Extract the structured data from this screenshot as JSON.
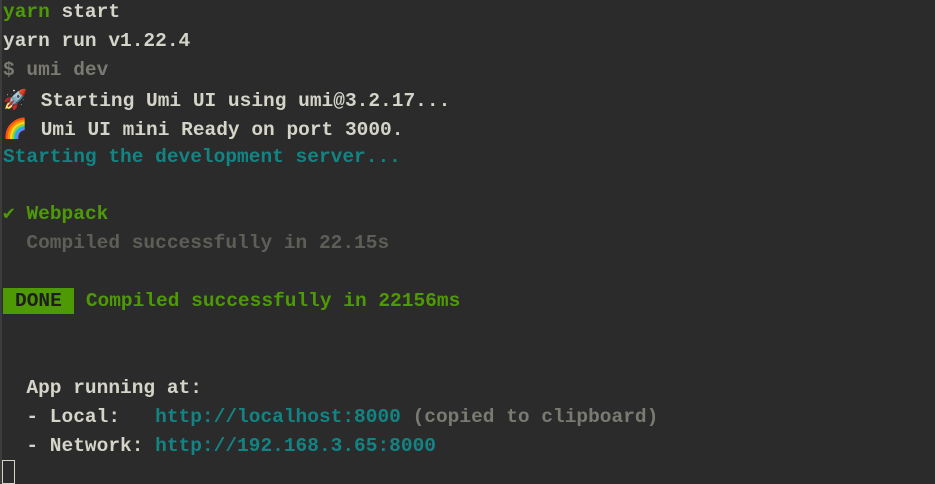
{
  "colors": {
    "background": "#2b2b2b",
    "green": "#4e9a06",
    "teal": "#138484",
    "text": "#d4d4c8"
  },
  "lines": {
    "cmd_prefix": "yarn",
    "cmd_rest": " start",
    "yarn_version": "yarn run v1.22.4",
    "umi_cmd": "$ umi dev",
    "rocket_icon": "🚀",
    "starting_umi": "Starting Umi UI using umi@3.2.17...",
    "rainbow_icon": "🌈",
    "umi_ready": "Umi UI mini Ready on port 3000.",
    "starting_dev": "Starting the development server...",
    "check_mark": "✔",
    "webpack_label": "Webpack",
    "compiled_webpack": "  Compiled successfully in 22.15s",
    "done_badge": "DONE",
    "done_message": "Compiled successfully in 22156ms",
    "app_running": "  App running at:",
    "local_label": "  - Local:   ",
    "local_url": "http://localhost:8000",
    "local_note": " (copied to clipboard)",
    "network_label": "  - Network: ",
    "network_url": "http://192.168.3.65:8000"
  }
}
